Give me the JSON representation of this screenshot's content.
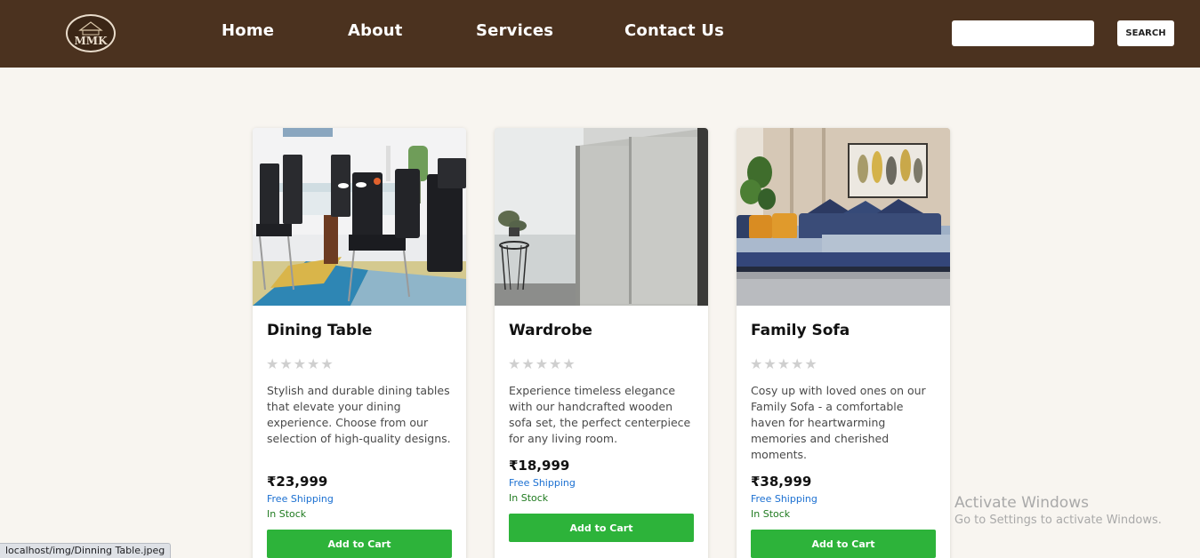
{
  "header": {
    "logo_text": "MMK",
    "nav": [
      {
        "label": "Home"
      },
      {
        "label": "About"
      },
      {
        "label": "Services"
      },
      {
        "label": "Contact Us"
      }
    ],
    "search": {
      "placeholder": "",
      "value": "",
      "button_label": "SEARCH"
    }
  },
  "products": [
    {
      "name": "Dining Table",
      "rating": 0,
      "stars": "★★★★★",
      "description": "Stylish and durable dining tables that elevate your dining experience. Choose from our selection of high-quality designs.",
      "price": "₹23,999",
      "shipping": "Free Shipping",
      "stock": "In Stock",
      "button": "Add to Cart"
    },
    {
      "name": "Wardrobe",
      "rating": 0,
      "stars": "★★★★★",
      "description": "Experience timeless elegance with our handcrafted wooden sofa set, the perfect centerpiece for any living room.",
      "price": "₹18,999",
      "shipping": "Free Shipping",
      "stock": "In Stock",
      "button": "Add to Cart"
    },
    {
      "name": "Family Sofa",
      "rating": 0,
      "stars": "★★★★★",
      "description": "Cosy up with loved ones on our Family Sofa - a comfortable haven for heartwarming memories and cherished moments.",
      "price": "₹38,999",
      "shipping": "Free Shipping",
      "stock": "In Stock",
      "button": "Add to Cart"
    }
  ],
  "status_bar": {
    "url": "localhost/img/Dinning Table.jpeg"
  },
  "watermark": {
    "title": "Activate Windows",
    "subtitle": "Go to Settings to activate Windows."
  },
  "colors": {
    "header_bg": "#4b321f",
    "page_bg": "#f8f5f0",
    "button_green": "#2db33a",
    "shipping_blue": "#1a6fd1",
    "stock_green": "#1f7a1f"
  }
}
